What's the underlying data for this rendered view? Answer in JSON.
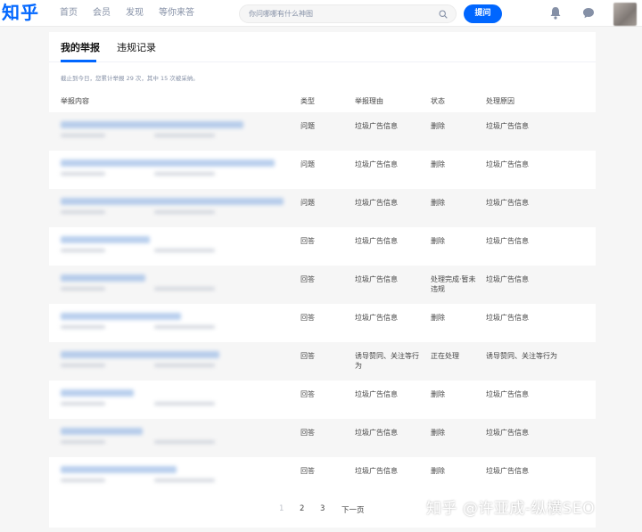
{
  "header": {
    "logo": "知乎",
    "nav": [
      "首页",
      "会员",
      "发现",
      "等你来答"
    ],
    "search_placeholder": "你问哪哪有什么神图",
    "ask_label": "提问"
  },
  "tabs": [
    "我的举报",
    "违规记录"
  ],
  "summary": "截止到今日，您累计举报 29 次，其中 15 次被采纳。",
  "table": {
    "headers": [
      "举报内容",
      "类型",
      "举报理由",
      "状态",
      "处理原因"
    ],
    "rows": [
      {
        "type": "问题",
        "reason": "垃圾广告信息",
        "status": "删除",
        "result": "垃圾广告信息"
      },
      {
        "type": "问题",
        "reason": "垃圾广告信息",
        "status": "删除",
        "result": "垃圾广告信息"
      },
      {
        "type": "问题",
        "reason": "垃圾广告信息",
        "status": "删除",
        "result": "垃圾广告信息"
      },
      {
        "type": "回答",
        "reason": "垃圾广告信息",
        "status": "删除",
        "result": "垃圾广告信息"
      },
      {
        "type": "回答",
        "reason": "垃圾广告信息",
        "status": "处理完成·暂未违规",
        "result": "垃圾广告信息"
      },
      {
        "type": "回答",
        "reason": "垃圾广告信息",
        "status": "删除",
        "result": "垃圾广告信息"
      },
      {
        "type": "回答",
        "reason": "诱导赞同、关注等行为",
        "status": "正在处理",
        "result": "诱导赞同、关注等行为"
      },
      {
        "type": "回答",
        "reason": "垃圾广告信息",
        "status": "删除",
        "result": "垃圾广告信息"
      },
      {
        "type": "回答",
        "reason": "垃圾广告信息",
        "status": "删除",
        "result": "垃圾广告信息"
      },
      {
        "type": "回答",
        "reason": "垃圾广告信息",
        "status": "删除",
        "result": "垃圾广告信息"
      }
    ]
  },
  "pagination": {
    "pages": [
      "1",
      "2",
      "3"
    ],
    "next": "下一页",
    "current": "1"
  },
  "watermark": "知乎 @许亚成-纵横SEO",
  "colors": {
    "accent": "#0066ff",
    "row_alt": "#f6f6f6"
  }
}
